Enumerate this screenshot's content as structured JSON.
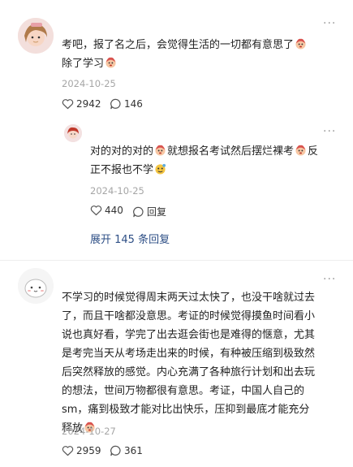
{
  "comment1": {
    "text_line1": "考吧，报了名之后，会觉得生活的一切都有意思了",
    "text_line2": "除了学习",
    "date": "2024-10-25",
    "likes": "2942",
    "replies": "146"
  },
  "reply1": {
    "text_line1_a": "对的对的对的",
    "text_line1_b": "就想报名考试然后摆烂裸考",
    "text_line1_c": "反",
    "text_line2": "正不报也不学",
    "date": "2024-10-25",
    "likes": "440",
    "reply_label": "回复"
  },
  "expand_replies": "展开 145 条回复",
  "comment2": {
    "lines": [
      "不学习的时候觉得周末两天过太快了，也没干啥就过去",
      "了，而且干啥都没意思。考证的时候觉得摸鱼时间看小",
      "说也真好看，学完了出去逛会街也是难得的惬意，尤其",
      "是考完当天从考场走出来的时候，有种被压缩到极致然",
      "后突然释放的感觉。内心充满了各种旅行计划和出去玩",
      "的想法，世间万物都很有意思。考证，中国人自己的",
      "sm，痛到极致才能对比出快乐，压抑到最底才能充分",
      "释放"
    ],
    "date": "2024-10-27",
    "likes": "2959",
    "replies": "361"
  },
  "colors": {
    "link": "#2e4f86",
    "date": "#a6a6a6",
    "divider": "#eeeeee"
  },
  "icons": [
    "heart-icon",
    "comment-icon",
    "more-icon",
    "emoji-icon",
    "avatar"
  ]
}
